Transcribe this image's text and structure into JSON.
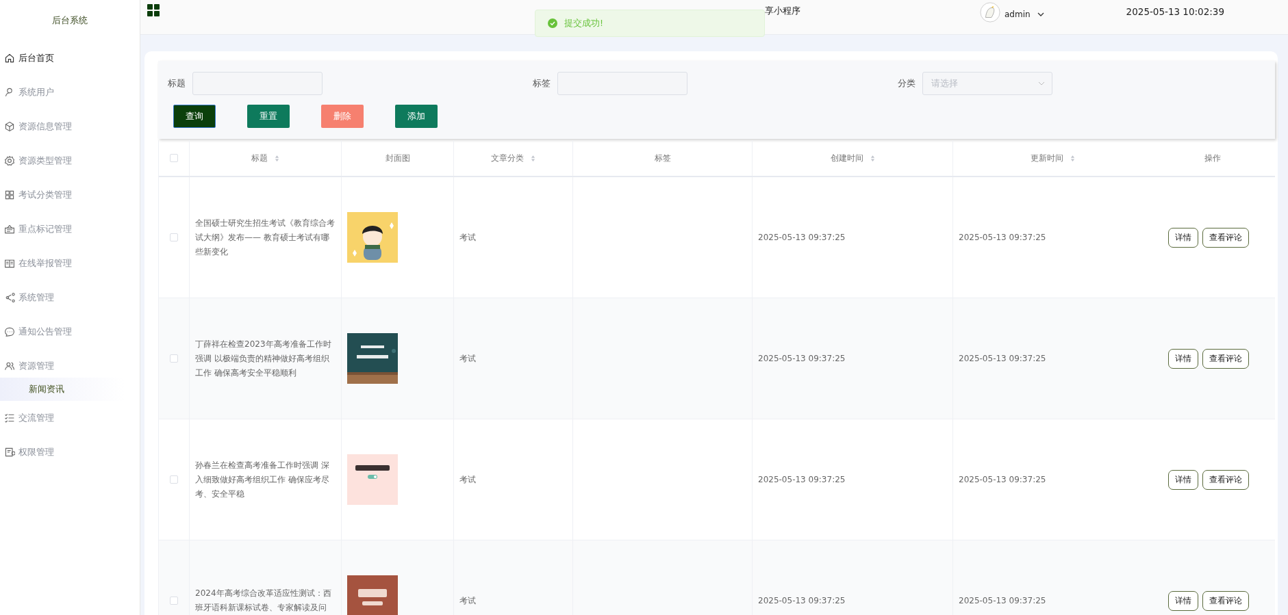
{
  "sidebar": {
    "title": "后台系统",
    "items": [
      {
        "label": "后台首页",
        "highlighted": true
      },
      {
        "label": "系统用户",
        "highlighted": false
      },
      {
        "label": "资源信息管理",
        "highlighted": false
      },
      {
        "label": "资源类型管理",
        "highlighted": false
      },
      {
        "label": "考试分类管理",
        "highlighted": false
      },
      {
        "label": "重点标记管理",
        "highlighted": false
      },
      {
        "label": "在线举报管理",
        "highlighted": false
      },
      {
        "label": "系统管理",
        "highlighted": false
      },
      {
        "label": "通知公告管理",
        "highlighted": false
      },
      {
        "label": "资源管理",
        "highlighted": false,
        "expanded": true,
        "children": [
          {
            "label": "新闻资讯",
            "selected": true
          }
        ]
      },
      {
        "label": "交流管理",
        "highlighted": false
      },
      {
        "label": "权限管理",
        "highlighted": false
      }
    ]
  },
  "header": {
    "title": "享小程序",
    "user": "admin",
    "datetime": "2025-05-13 10:02:39"
  },
  "toast": {
    "message": "提交成功!"
  },
  "filters": [
    {
      "label": "标题",
      "kind": "input"
    },
    {
      "label": "标签",
      "kind": "input"
    },
    {
      "label": "分类",
      "kind": "select",
      "placeholder": "请选择"
    }
  ],
  "buttons": [
    {
      "label": "查询",
      "kind": "primary"
    },
    {
      "label": "重置",
      "kind": "default"
    },
    {
      "label": "删除",
      "kind": "danger"
    },
    {
      "label": "添加",
      "kind": "default"
    }
  ],
  "table": {
    "select_all": {
      "checked": false
    },
    "columns": [
      {
        "label": "标题",
        "sortable": true
      },
      {
        "label": "封面图"
      },
      {
        "label": "文章分类",
        "sortable": true
      },
      {
        "label": "标签"
      },
      {
        "label": "创建时间",
        "sortable": true
      },
      {
        "label": "更新时间",
        "sortable": true
      },
      {
        "label": "操作"
      }
    ],
    "rows": [
      {
        "checked": false,
        "title": "全国硕士研究生招生考试《教育综合考试大纲》发布—— 教育硕士考试有哪些新变化",
        "cover": {
          "kind": "picture"
        },
        "category": "考试",
        "created": "2025-05-13 09:37:25",
        "updated": "2025-05-13 09:37:25",
        "actions": [
          "详情",
          "查看评论"
        ]
      },
      {
        "checked": false,
        "title": "丁薛祥在检查2023年高考准备工作时强调 以极端负责的精神做好高考组织工作 确保高考安全平稳顺利",
        "cover": {
          "kind": "picture"
        },
        "category": "考试",
        "created": "2025-05-13 09:37:25",
        "updated": "2025-05-13 09:37:25",
        "actions": [
          "详情",
          "查看评论"
        ]
      },
      {
        "checked": false,
        "title": "孙春兰在检查高考准备工作时强调 深入细致做好高考组织工作 确保应考尽考、安全平稳",
        "cover": {
          "kind": "picture"
        },
        "category": "考试",
        "created": "2025-05-13 09:37:25",
        "updated": "2025-05-13 09:37:25",
        "actions": [
          "详情",
          "查看评论"
        ]
      },
      {
        "checked": false,
        "title": "2024年高考综合改革适应性测试：西班牙语科新课标试卷、专家解读及问",
        "cover": {
          "kind": "picture"
        },
        "category": "考试",
        "created": "2025-05-13 09:37:25",
        "updated": "2025-05-13 09:37:25",
        "actions": [
          "详情",
          "查看评论"
        ]
      }
    ]
  }
}
